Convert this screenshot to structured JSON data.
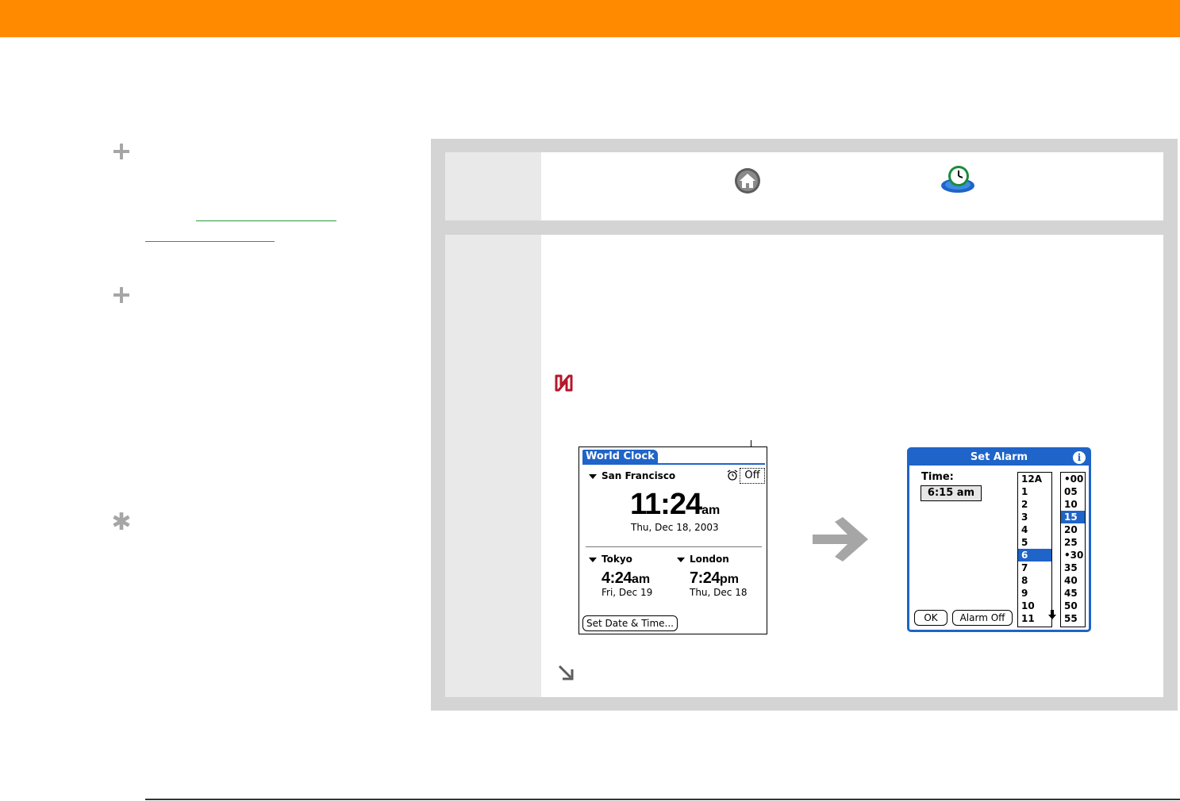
{
  "colors": {
    "header_bar": "#ff8a00",
    "panel_gray": "#d4d4d4",
    "link_green": "#2a9d3a",
    "palm_blue": "#1f64c8",
    "tip_red": "#b4182a",
    "arrow_gray": "#a6a6a6"
  },
  "sidebar": {
    "icons": [
      "plus-icon",
      "plus-icon",
      "asterisk-icon"
    ]
  },
  "steps": {
    "step1": {
      "icons": [
        "home-icon",
        "world-clock-app-icon"
      ]
    },
    "step2": {
      "icons": [
        "tip-icon",
        "continue-arrow-icon"
      ]
    }
  },
  "world_clock": {
    "title": "World Clock",
    "primary_city": "San Francisco",
    "alarm_state": "Off",
    "primary_time": "11:24",
    "primary_ampm": "am",
    "primary_date": "Thu, Dec 18, 2003",
    "city2": {
      "name": "Tokyo",
      "time": "4:24",
      "ampm": "am",
      "date": "Fri, Dec 19"
    },
    "city3": {
      "name": "London",
      "time": "7:24",
      "ampm": "pm",
      "date": "Thu, Dec 18"
    },
    "set_button": "Set Date & Time..."
  },
  "set_alarm": {
    "title": "Set Alarm",
    "info_glyph": "i",
    "time_label": "Time:",
    "time_value": "6:15 am",
    "ok_button": "OK",
    "alarm_off_button": "Alarm Off",
    "hours": [
      "12A",
      "1",
      "2",
      "3",
      "4",
      "5",
      "6",
      "7",
      "8",
      "9",
      "10",
      "11"
    ],
    "selected_hour": "6",
    "minutes": [
      "•00",
      "05",
      "10",
      "15",
      "20",
      "25",
      "•30",
      "35",
      "40",
      "45",
      "50",
      "55"
    ],
    "selected_minute": "15"
  }
}
